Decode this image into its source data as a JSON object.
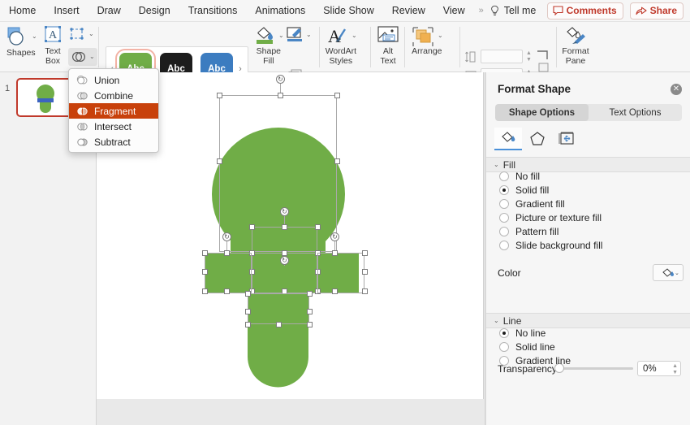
{
  "menubar": {
    "items": [
      "Home",
      "Insert",
      "Draw",
      "Design",
      "Transitions",
      "Animations",
      "Slide Show",
      "Review",
      "View"
    ],
    "overflow": "»",
    "tell_me": "Tell me",
    "comments": "Comments",
    "share": "Share",
    "accent_color": "#c0392b"
  },
  "ribbon": {
    "shapes": {
      "label": "Shapes",
      "caret": "⌄"
    },
    "textbox": {
      "label": "Text\nBox"
    },
    "arrange_small": {
      "caret": "⌄"
    },
    "merge": {
      "caret": "⌄"
    },
    "gallery": {
      "prev": "‹",
      "next": "›",
      "items": [
        {
          "text": "Abc",
          "fill": "#70AD47",
          "color": "#ffffff",
          "selected": true
        },
        {
          "text": "Abc",
          "fill": "#1d1d1d",
          "color": "#ffffff",
          "selected": false
        },
        {
          "text": "Abc",
          "fill": "#3C7CC0",
          "color": "#ffffff",
          "selected": false
        }
      ]
    },
    "shape_fill": {
      "label": "Shape\nFill",
      "swatch": "#70AD47",
      "caret": "⌄"
    },
    "shape_outline": {
      "caret": "⌄"
    },
    "shape_effects": {
      "caret": "⌄"
    },
    "wordart": {
      "label": "WordArt\nStyles",
      "caret": "⌄"
    },
    "alt_text": {
      "label": "Alt\nText"
    },
    "arrange": {
      "label": "Arrange",
      "caret": "⌄"
    },
    "height_value": "",
    "width_value": "",
    "format_pane": {
      "label": "Format\nPane"
    }
  },
  "merge_menu": {
    "items": [
      {
        "label": "Union",
        "icon": "union-icon",
        "highlighted": false
      },
      {
        "label": "Combine",
        "icon": "combine-icon",
        "highlighted": false
      },
      {
        "label": "Fragment",
        "icon": "fragment-icon",
        "highlighted": true
      },
      {
        "label": "Intersect",
        "icon": "intersect-icon",
        "highlighted": false
      },
      {
        "label": "Subtract",
        "icon": "subtract-icon",
        "highlighted": false
      }
    ],
    "highlight_color": "#c8410b"
  },
  "slides": {
    "thumbnail_number": "1"
  },
  "canvas": {
    "shape_fill_color": "#70AD47",
    "bar_color": "#3C63C0"
  },
  "format_pane": {
    "title": "Format Shape",
    "close": "✕",
    "tabs": [
      {
        "label": "Shape Options",
        "active": true
      },
      {
        "label": "Text Options",
        "active": false
      }
    ],
    "icon_tabs": [
      {
        "name": "fill-and-line-icon",
        "active": true
      },
      {
        "name": "effects-pentagon-icon",
        "active": false
      },
      {
        "name": "size-and-properties-icon",
        "active": false
      }
    ],
    "fill": {
      "section_label": "Fill",
      "chevron": "⌄",
      "options": [
        {
          "label": "No fill",
          "selected": false
        },
        {
          "label": "Solid fill",
          "selected": true
        },
        {
          "label": "Gradient fill",
          "selected": false
        },
        {
          "label": "Picture or texture fill",
          "selected": false
        },
        {
          "label": "Pattern fill",
          "selected": false
        },
        {
          "label": "Slide background fill",
          "selected": false
        }
      ],
      "color_label": "Color",
      "color_caret": "⌄",
      "transparency_label": "Transparency",
      "transparency_value": "0%"
    },
    "line": {
      "section_label": "Line",
      "chevron": "⌄",
      "options": [
        {
          "label": "No line",
          "selected": true
        },
        {
          "label": "Solid line",
          "selected": false
        },
        {
          "label": "Gradient line",
          "selected": false
        }
      ]
    }
  }
}
